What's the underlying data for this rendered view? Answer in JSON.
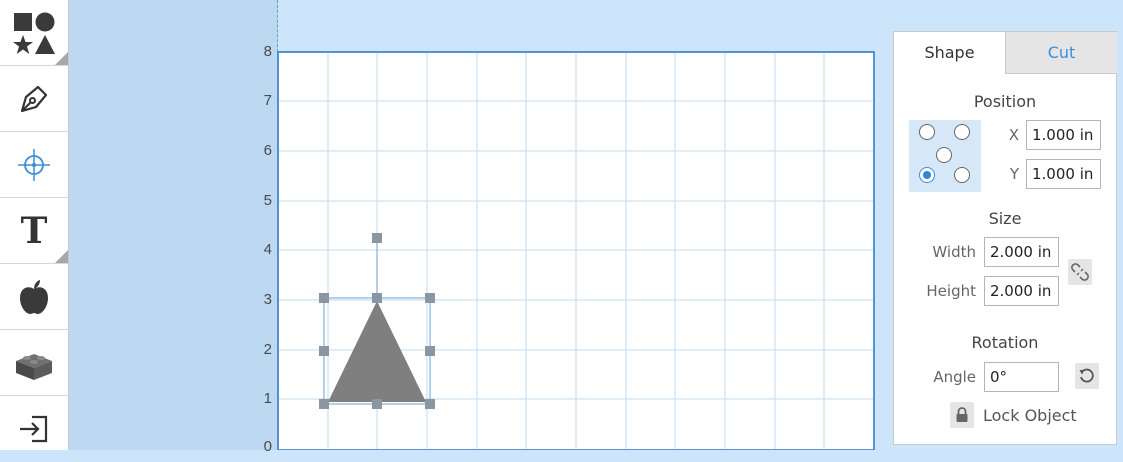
{
  "toolbar": {
    "tools": [
      {
        "name": "shapes-tool",
        "icon": "shapes-icon"
      },
      {
        "name": "pen-tool",
        "icon": "pen-nib-icon"
      },
      {
        "name": "point-tool",
        "icon": "crosshair-icon"
      },
      {
        "name": "text-tool",
        "icon": "text-icon",
        "glyph": "T"
      },
      {
        "name": "image-tool",
        "icon": "apple-icon"
      },
      {
        "name": "3d-tool",
        "icon": "brick-icon"
      },
      {
        "name": "import-tool",
        "icon": "import-icon"
      }
    ]
  },
  "canvas": {
    "y_labels": [
      "8",
      "7",
      "6",
      "5",
      "4",
      "3",
      "2",
      "1",
      "0"
    ],
    "shape": {
      "type": "triangle",
      "fill": "#7f7f7f"
    },
    "grid_color": "#c2dbf1",
    "handle_color": "#8b96a3"
  },
  "panel": {
    "tabs": {
      "shape": "Shape",
      "cut": "Cut"
    },
    "position": {
      "title": "Position",
      "x_label": "X",
      "x_value": "1.000 in",
      "y_label": "Y",
      "y_value": "1.000 in",
      "anchor_selected": "bottom-left"
    },
    "size": {
      "title": "Size",
      "width_label": "Width",
      "width_value": "2.000 in",
      "height_label": "Height",
      "height_value": "2.000 in"
    },
    "rotation": {
      "title": "Rotation",
      "angle_label": "Angle",
      "angle_value": "0°"
    },
    "lock_label": "Lock Object"
  },
  "colors": {
    "accent": "#3a8fd8",
    "workspace": "#cde5fa",
    "gutter": "#bcd9f1"
  }
}
